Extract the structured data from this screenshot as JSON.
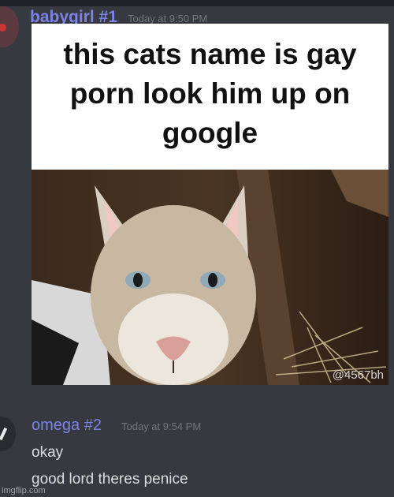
{
  "messages": [
    {
      "username": "babygirl #1",
      "timestamp": "Today at 9:50 PM",
      "attachment": {
        "caption": "this cats name is gay porn look him up on google",
        "watermark": "@4567bh"
      }
    },
    {
      "username": "omega #2",
      "timestamp": "Today at 9:54 PM",
      "lines": [
        "okay",
        "good lord theres penice"
      ]
    }
  ],
  "footer_watermark": "imgflip.com",
  "colors": {
    "background": "#36393f",
    "username": "#7d83e6",
    "timestamp": "#72767d",
    "text": "#dcddde"
  }
}
